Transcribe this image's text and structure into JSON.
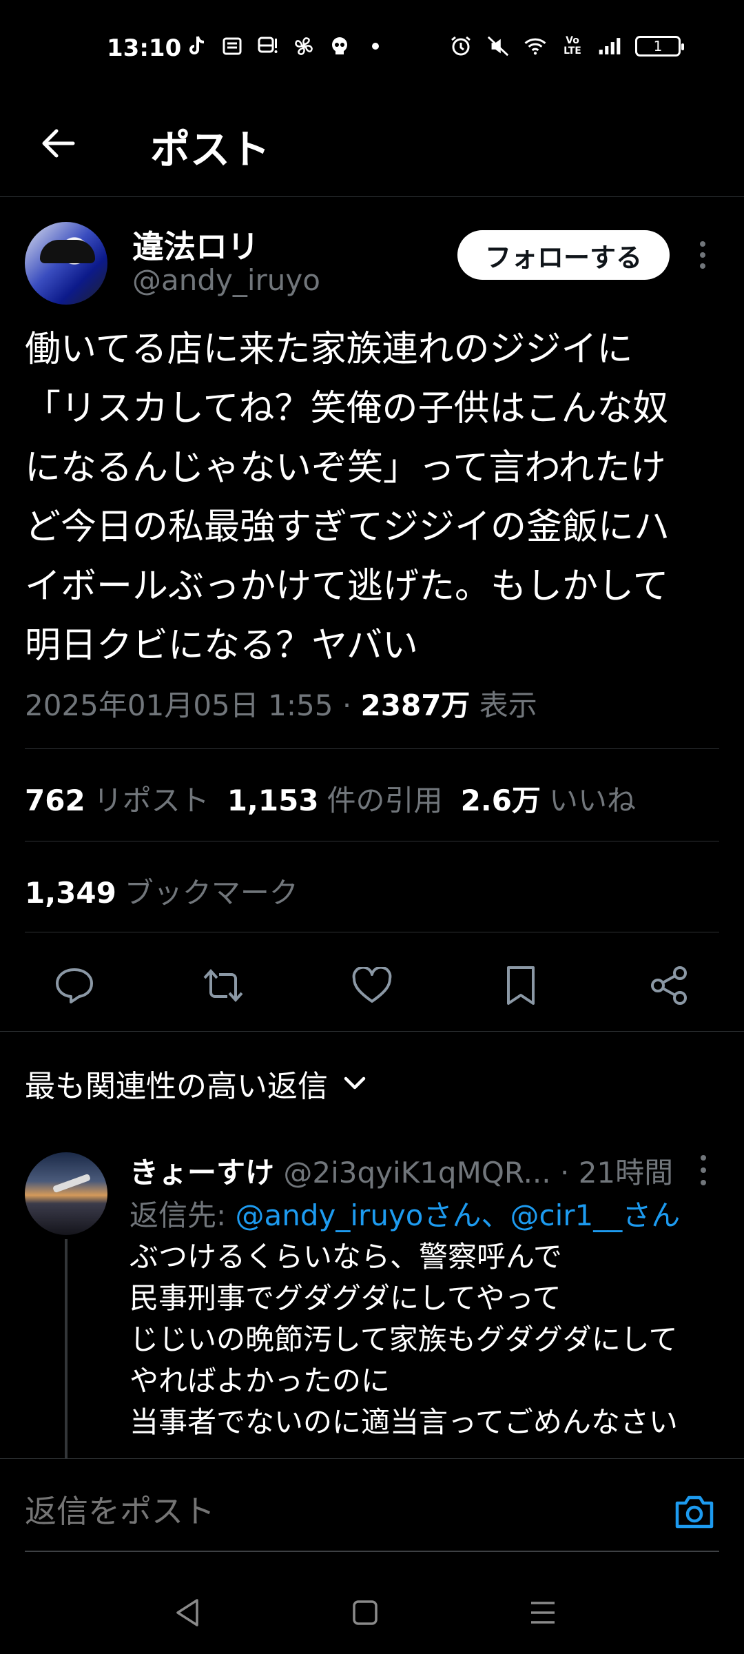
{
  "status_bar": {
    "time": "13:10",
    "battery": "1",
    "left_icons": [
      "tiktok-icon",
      "news-icon",
      "bus-icon",
      "fan-icon",
      "skull-icon",
      "dot-icon"
    ],
    "right_icons": [
      "alarm-icon",
      "mute-icon",
      "wifi-icon",
      "volte-icon",
      "signal-icon",
      "battery-icon"
    ],
    "volte_label": "Vo LTE"
  },
  "header": {
    "title": "ポスト"
  },
  "author": {
    "name": "違法ロリ",
    "handle": "@andy_iruyo",
    "follow_label": "フォローする"
  },
  "tweet": {
    "lines": [
      "働いてる店に来た家族連れのジジイに",
      "「リスカしてね？笑俺の子供はこんな奴",
      "になるんじゃないぞ笑」って言われたけ",
      "ど今日の私最強すぎてジジイの釜飯にハ",
      "イボールぶっかけて逃げた。もしかして",
      "明日クビになる？ヤバい"
    ],
    "timestamp": "2025年01月05日 1:55",
    "separator": "·",
    "views": "2387万",
    "views_label": "表示"
  },
  "stats": {
    "reposts": "762",
    "reposts_label": "リポスト",
    "quotes": "1,153",
    "quotes_label": "件の引用",
    "likes": "2.6万",
    "likes_label": "いいね",
    "bookmarks": "1,349",
    "bookmarks_label": "ブックマーク"
  },
  "sort": {
    "label": "最も関連性の高い返信"
  },
  "reply": {
    "name": "きょーすけ",
    "handle": "@2i3qyiK1qMQR...",
    "time": "· 21時間",
    "reply_to_prefix": "返信先: ",
    "reply_to_links": "@andy_iruyoさん、@cir1__さん",
    "lines": [
      "ぶつけるくらいなら、警察呼んで",
      "民事刑事でグダグダにしてやって",
      "じじいの晩節汚して家族もグダグダにして",
      "やればよかったのに",
      "当事者でないのに適当言ってごめんなさい"
    ]
  },
  "composer": {
    "placeholder": "返信をポスト"
  },
  "colors": {
    "accent": "#1d9bf0",
    "muted": "#71767b",
    "background": "#000000",
    "divider": "#2f3336"
  }
}
